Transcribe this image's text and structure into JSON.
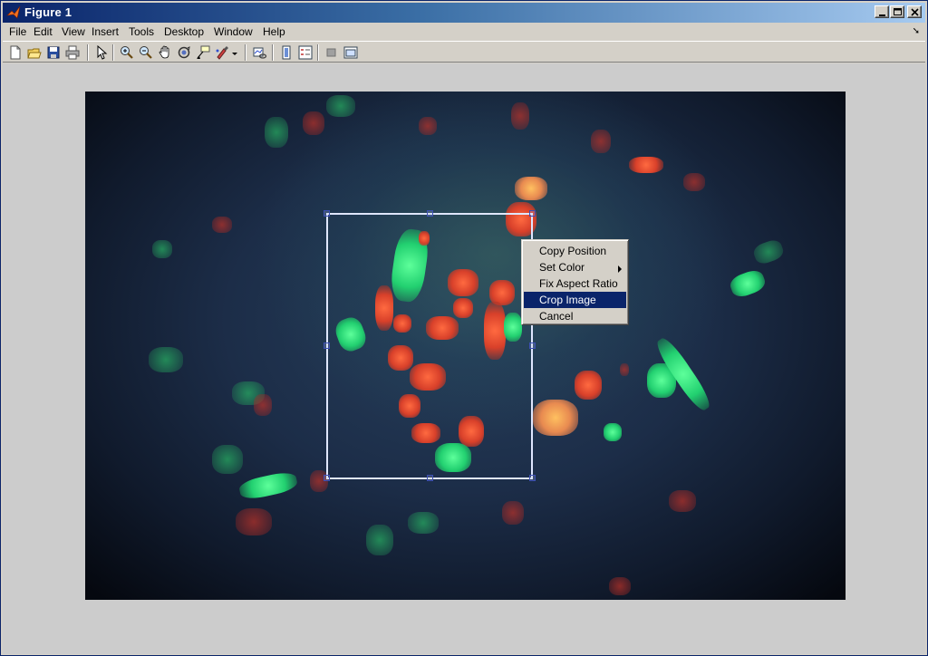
{
  "window": {
    "title": "Figure 1"
  },
  "menubar": {
    "items": [
      "File",
      "Edit",
      "View",
      "Insert",
      "Tools",
      "Desktop",
      "Window",
      "Help"
    ]
  },
  "toolbar": {
    "tools": [
      "new-figure-icon",
      "open-file-icon",
      "save-icon",
      "print-icon",
      "edit-plot-icon",
      "zoom-in-icon",
      "zoom-out-icon",
      "pan-icon",
      "rotate-3d-icon",
      "data-cursor-icon",
      "brush-icon",
      "link-plot-icon",
      "colorbar-icon",
      "legend-icon",
      "hide-plot-tools-icon",
      "show-plot-tools-icon"
    ]
  },
  "context_menu": {
    "items": [
      {
        "label": "Copy Position"
      },
      {
        "label": "Set Color",
        "submenu": true
      },
      {
        "label": "Fix Aspect Ratio"
      },
      {
        "label": "Crop Image",
        "selected": true
      },
      {
        "label": "Cancel"
      }
    ]
  },
  "colors": {
    "title_bar_start": "#0a246a",
    "title_bar_end": "#a6caf0",
    "menu_highlight": "#0a246a",
    "window_face": "#d4d0c8",
    "figure_background": "#cccccc",
    "crop_rectangle": "#dfe6ff"
  }
}
